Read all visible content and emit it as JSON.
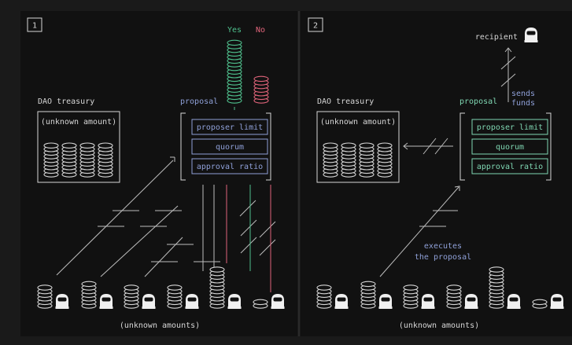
{
  "panels": [
    {
      "number": "1",
      "treasury_title": "DAO treasury",
      "treasury_amount": "(unknown amount)",
      "proposal_title": "proposal",
      "proposal_rows": [
        "proposer limit",
        "quorum",
        "approval ratio"
      ],
      "bottom_caption": "(unknown amounts)",
      "vote_yes": "Yes",
      "vote_no": "No"
    },
    {
      "number": "2",
      "treasury_title": "DAO treasury",
      "treasury_amount": "(unknown amount)",
      "proposal_title": "proposal",
      "proposal_rows": [
        "proposer limit",
        "quorum",
        "approval ratio"
      ],
      "bottom_caption": "(unknown amounts)",
      "recipient": "recipient",
      "sends_funds": [
        "sends",
        "funds"
      ],
      "executes": [
        "executes",
        "the proposal"
      ]
    }
  ],
  "colors": {
    "background": "#111111",
    "frame": "#1a1a1a",
    "ink": "#d6d6d6",
    "proposal_blue": "#8fa0d8",
    "teal": "#7fd6b2",
    "yes_green": "#4fc08d",
    "no_red": "#e0647a"
  }
}
